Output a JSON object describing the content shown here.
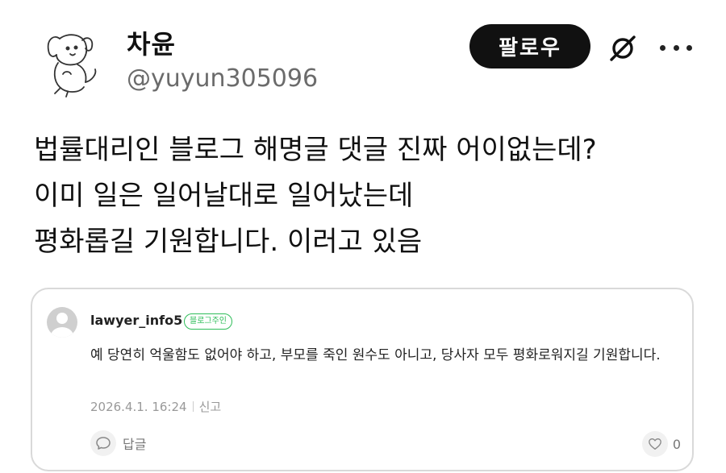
{
  "profile": {
    "display_name": "차윤",
    "handle": "@yuyun305096",
    "avatar_icon": "puppy-doodle-icon"
  },
  "actions": {
    "follow_label": "팔로우",
    "grok_icon": "grok-icon",
    "more_icon": "more-dots-icon"
  },
  "tweet": {
    "lines": [
      "법률대리인 블로그 해명글 댓글 진짜 어이없는데?",
      "이미 일은 일어날대로 일어났는데",
      "평화롭길 기원합니다. 이러고 있음"
    ]
  },
  "comment": {
    "author": "lawyer_info5",
    "badge": "블로그주인",
    "body": "예 당연히 억울함도 없어야 하고, 부모를 죽인 원수도 아니고, 당사자 모두 평화로워지길 기원합니다.",
    "date": "2026.4.1. 16:24",
    "report": "신고",
    "reply_label": "답글",
    "like_count": "0",
    "colors": {
      "badge": "#2ebd59",
      "border": "#d9d9d9"
    }
  }
}
